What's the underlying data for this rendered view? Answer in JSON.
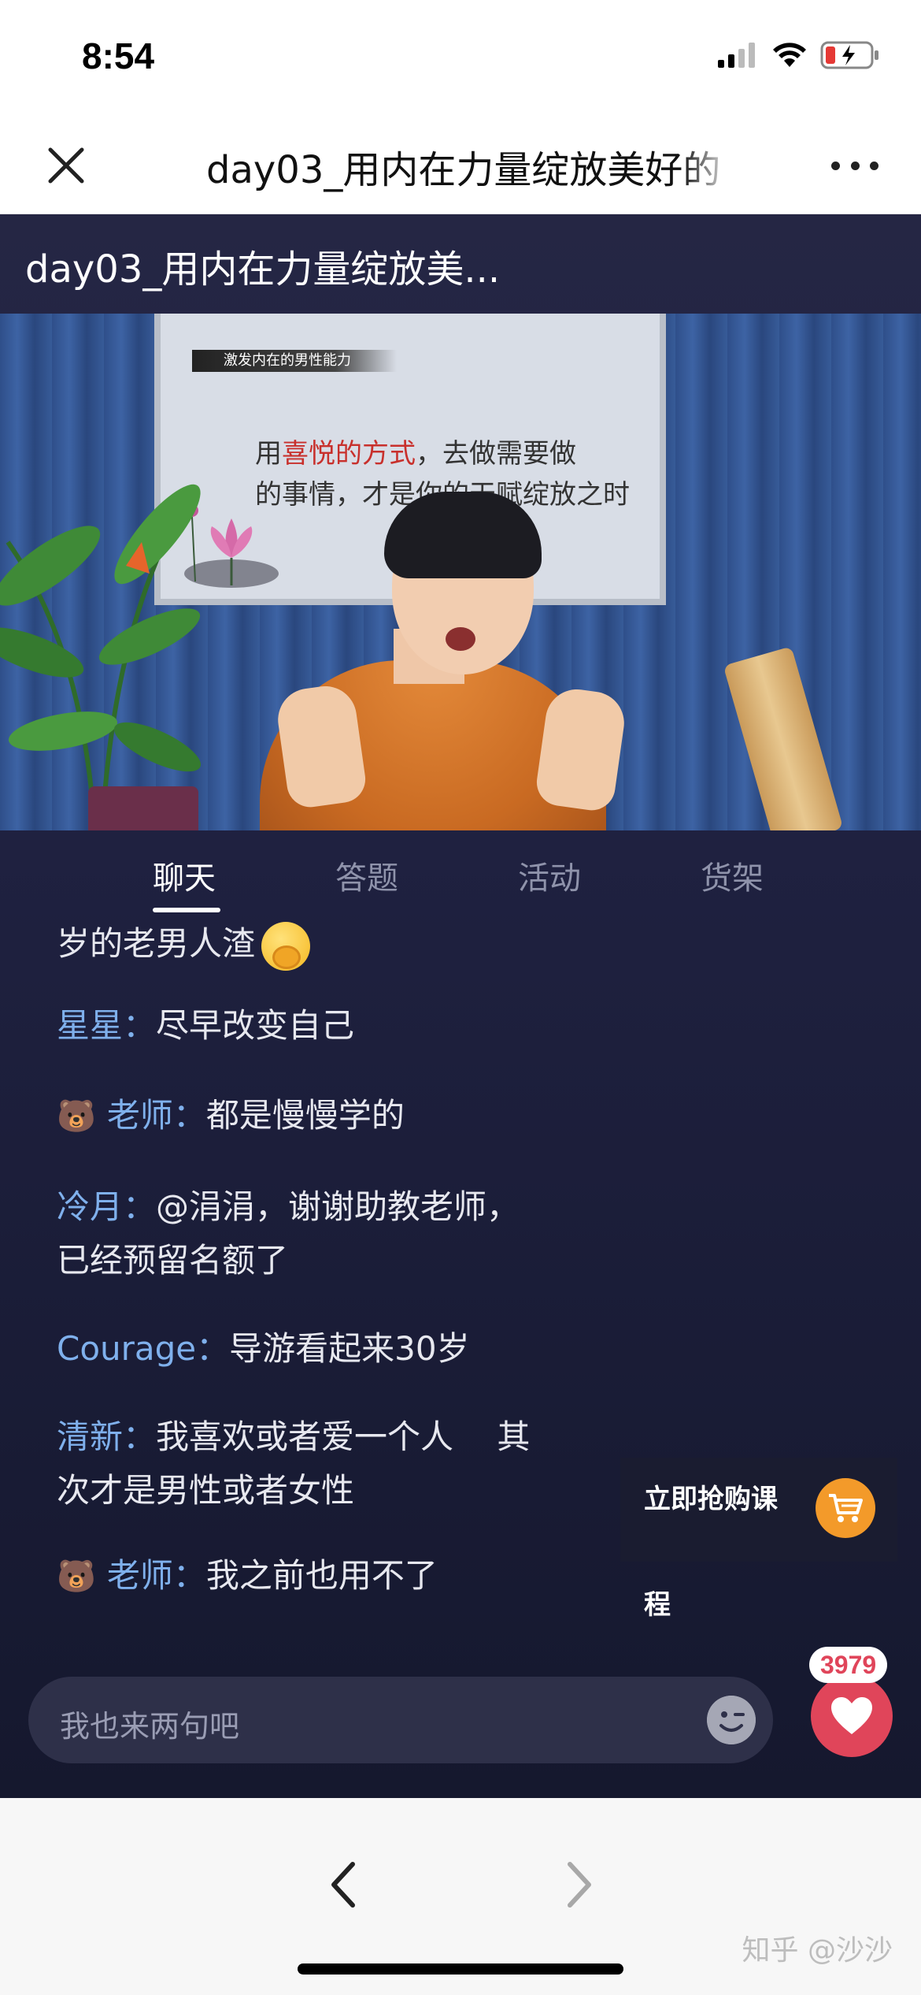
{
  "status_bar": {
    "time": "8:54"
  },
  "nav": {
    "title": "day03_用内在力量绽放美好的",
    "close_icon": "close-icon",
    "more_icon": "more-icon"
  },
  "video": {
    "title": "day03_用内在力量绽放美...",
    "board_heading": "激发内在的男性能力",
    "board_line1_a": "用",
    "board_line1_hl": "喜悦的方式",
    "board_line1_b": "，去做需要做",
    "board_line2": "的事情，才是你的天赋绽放之时"
  },
  "tabs": [
    {
      "label": "聊天",
      "active": true
    },
    {
      "label": "答题",
      "active": false
    },
    {
      "label": "活动",
      "active": false
    },
    {
      "label": "货架",
      "active": false
    }
  ],
  "chat": [
    {
      "name": "",
      "text": "岁的老男人渣"
    },
    {
      "name": "星星：",
      "text": "尽早改变自己"
    },
    {
      "name": "老师：",
      "text": "都是慢慢学的",
      "bear": true
    },
    {
      "name": "冷月：",
      "text": "@涓涓，谢谢助教老师，",
      "text2": "已经预留名额了"
    },
    {
      "name": "Courage：",
      "text": "导游看起来30岁"
    },
    {
      "name": "清新：",
      "text": "我喜欢或者爱一个人　 其",
      "text2": "次才是男性或者女性"
    },
    {
      "name": "老师：",
      "text": "我之前也用不了",
      "bear": true
    }
  ],
  "buy_card": {
    "label": "立即抢购课程",
    "icon": "cart-icon"
  },
  "input": {
    "placeholder": "我也来两句吧",
    "icon": "emoji-icon"
  },
  "likes": {
    "count": "3979",
    "icon": "heart-icon"
  },
  "browser": {
    "back_icon": "chevron-left-icon",
    "forward_icon": "chevron-right-icon",
    "watermark": "知乎 @沙沙"
  },
  "colors": {
    "accent_name": "#7fb0ec",
    "like": "#e0455a",
    "cart": "#f39a2a",
    "background": "#1f2140"
  }
}
